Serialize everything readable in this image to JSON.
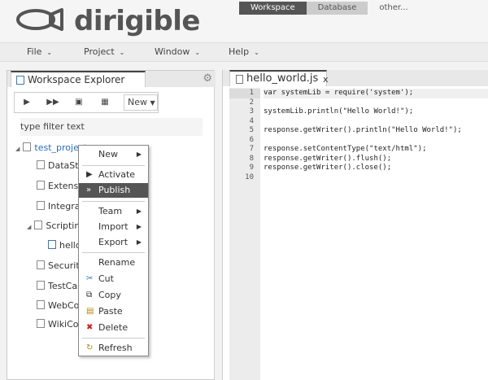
{
  "app": {
    "name": "dirigible",
    "perspectives": [
      "Workspace",
      "Database",
      "other..."
    ]
  },
  "menubar": [
    "File",
    "Project",
    "Window",
    "Help"
  ],
  "explorer": {
    "title": "Workspace Explorer",
    "new_label": "New",
    "filter_placeholder": "type filter text",
    "tree": {
      "project": "test_project",
      "items": [
        "DataStr",
        "Extensio",
        "Integra",
        "Scriptin",
        "hello",
        "Security",
        "TestCas",
        "WebCon",
        "WikiCon"
      ]
    }
  },
  "context_menu": {
    "items": [
      "New",
      "Activate",
      "Publish",
      "Team",
      "Import",
      "Export",
      "Rename",
      "Cut",
      "Copy",
      "Paste",
      "Delete",
      "Refresh"
    ],
    "highlighted": "Publish"
  },
  "editor": {
    "tab_title": "hello_world.js",
    "close": "x",
    "line_numbers": [
      "1",
      "2",
      "3",
      "4",
      "5",
      "6",
      "7",
      "8",
      "9",
      "10"
    ],
    "lines": [
      "var systemLib = require('system');",
      "",
      "systemLib.println(\"Hello World!\");",
      "",
      "response.getWriter().println(\"Hello World!\");",
      "",
      "response.setContentType(\"text/html\");",
      "response.getWriter().flush();",
      "response.getWriter().close();",
      ""
    ]
  },
  "colors": {
    "active_perspective": "#555555",
    "project_link": "#2a6ebb",
    "menu_highlight": "#555555"
  }
}
